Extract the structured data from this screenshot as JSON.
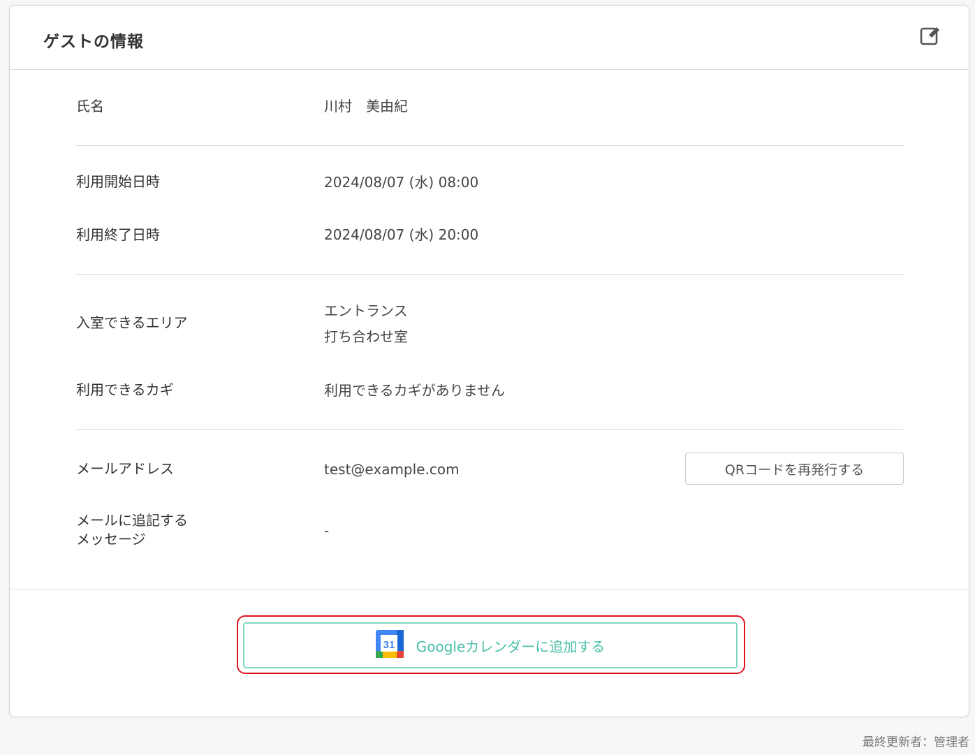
{
  "card": {
    "title": "ゲストの情報"
  },
  "fields": {
    "name": {
      "label": "氏名",
      "value": "川村　美由紀"
    },
    "start": {
      "label": "利用開始日時",
      "value": "2024/08/07 (水) 08:00"
    },
    "end": {
      "label": "利用終了日時",
      "value": "2024/08/07 (水) 20:00"
    },
    "areas": {
      "label": "入室できるエリア",
      "values": [
        "エントランス",
        "打ち合わせ室"
      ]
    },
    "keys": {
      "label": "利用できるカギ",
      "value": "利用できるカギがありません"
    },
    "email": {
      "label": "メールアドレス",
      "value": "test@example.com"
    },
    "message": {
      "label_line1": "メールに追記する",
      "label_line2": "メッセージ",
      "value": "-"
    }
  },
  "buttons": {
    "qr_reissue": "QRコードを再発行する",
    "google_calendar": "Googleカレンダーに追加する",
    "calendar_icon_day": "31"
  },
  "footer": {
    "last_updated": "最終更新者：管理者"
  },
  "colors": {
    "accent_teal": "#48bfa8",
    "highlight_red": "#e1121e"
  }
}
